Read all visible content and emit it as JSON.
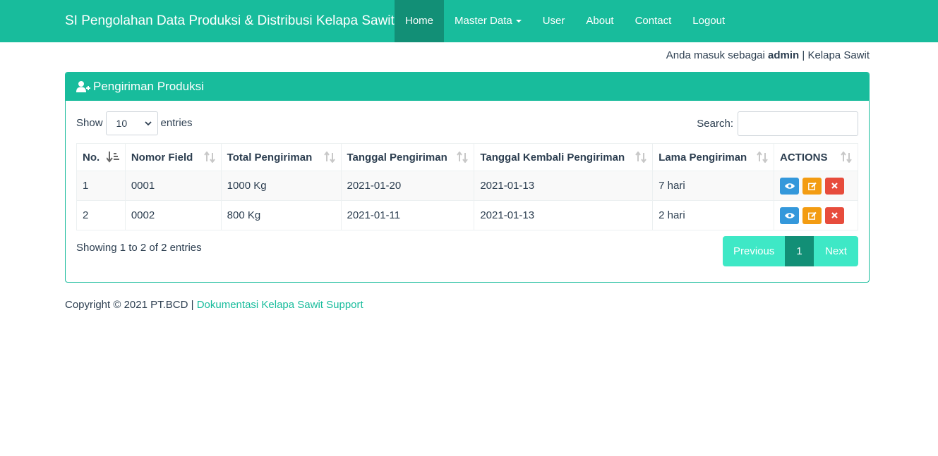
{
  "navbar": {
    "brand": "SI Pengolahan Data Produksi & Distribusi Kelapa Sawit",
    "items": [
      {
        "label": "Home"
      },
      {
        "label": "Master Data"
      },
      {
        "label": "User"
      },
      {
        "label": "About"
      },
      {
        "label": "Contact"
      },
      {
        "label": "Logout"
      }
    ]
  },
  "userline": {
    "prefix": "Anda masuk sebagai",
    "user": "admin",
    "suffix": "| Kelapa Sawit"
  },
  "panel": {
    "title": "Pengiriman Produksi"
  },
  "controls": {
    "show": "Show",
    "entries_value": "10",
    "entries": "entries",
    "search": "Search:"
  },
  "table": {
    "headers": [
      "No.",
      "Nomor Field",
      "Total Pengiriman",
      "Tanggal Pengiriman",
      "Tanggal Kembali Pengiriman",
      "Lama Pengiriman",
      "ACTIONS"
    ],
    "rows": [
      [
        "1",
        "0001",
        "1000 Kg",
        "2021-01-20",
        "2021-01-13",
        "7 hari"
      ],
      [
        "2",
        "0002",
        "800 Kg",
        "2021-01-11",
        "2021-01-13",
        "2 hari"
      ]
    ]
  },
  "info": "Showing 1 to 2 of 2 entries",
  "pagination": {
    "previous": "Previous",
    "current": "1",
    "next": "Next"
  },
  "footer": {
    "text": "Copyright © 2021 PT.BCD |",
    "link": "Dokumentasi Kelapa Sawit Support"
  },
  "colors": {
    "primary": "#18bc9c",
    "active": "#128f76",
    "view": "#3498db",
    "edit": "#f39c12",
    "delete": "#e74c3c"
  }
}
